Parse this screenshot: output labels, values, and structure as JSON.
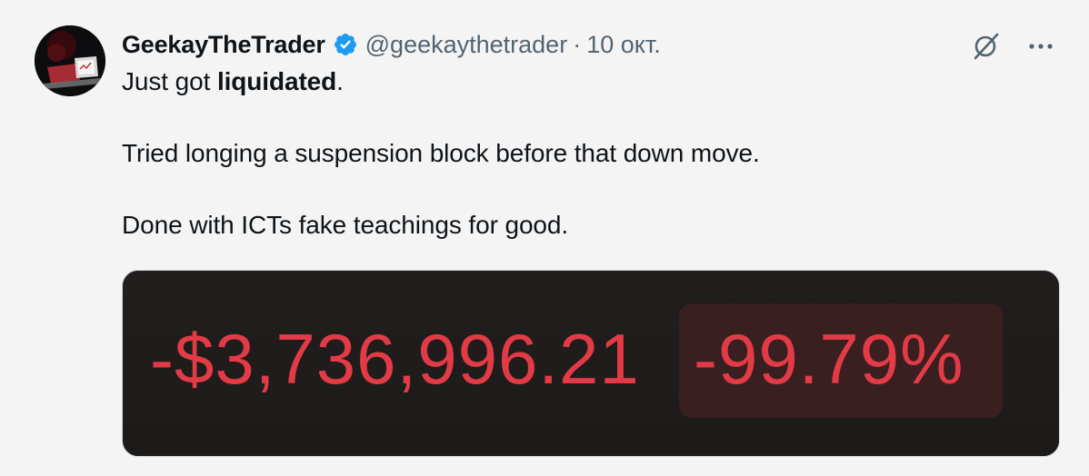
{
  "tweet": {
    "display_name": "GeekayTheTrader",
    "handle": "@geekaythetrader",
    "separator": "·",
    "date": "10 окт.",
    "line1_prefix": "Just got ",
    "line1_bold": "liquidated",
    "line1_suffix": ".",
    "line2": "Tried longing a suspension block before that down move.",
    "line3": "Done with ICTs fake teachings for good."
  },
  "media": {
    "pnl_amount": "-$3,736,996.21",
    "pnl_percent": "-99.79%",
    "loss_color": "#e23b46"
  },
  "icons": {
    "verified": "verified-badge-icon",
    "grok": "grok-icon",
    "more": "more-dots-icon"
  },
  "colors": {
    "background": "#f4f4f4",
    "verified_blue": "#1d9bf0",
    "secondary_text": "#536471"
  }
}
